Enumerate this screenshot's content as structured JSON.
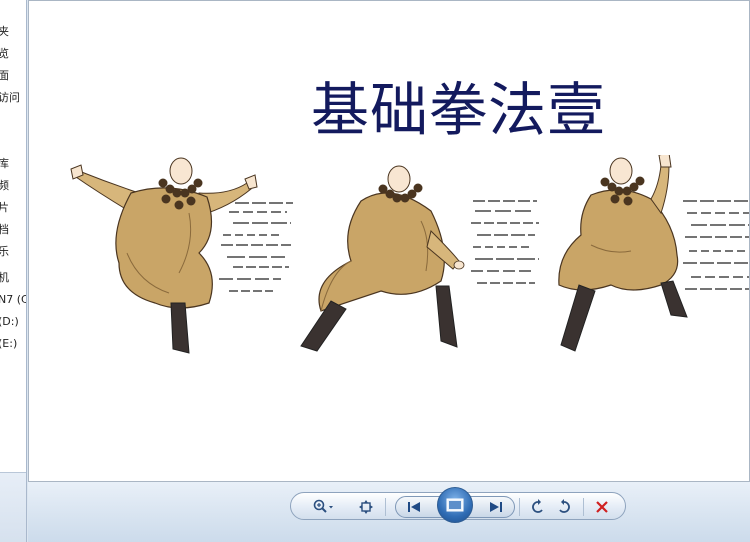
{
  "nav_pane": {
    "items": [
      "夹",
      "览",
      "面",
      "访问",
      "库",
      "频",
      "片",
      "档",
      "乐",
      "机",
      "N7 (C",
      "(D:)",
      "(E:)"
    ]
  },
  "viewer": {
    "slide_title": "基础拳法壹"
  },
  "toolbar": {
    "zoom_icon": "zoom-icon",
    "fit_icon": "actual-size-icon",
    "prev_icon": "previous-icon",
    "slideshow_icon": "slideshow-icon",
    "next_icon": "next-icon",
    "rotate_ccw_icon": "rotate-counterclockwise-icon",
    "rotate_cw_icon": "rotate-clockwise-icon",
    "delete_icon": "delete-icon"
  },
  "colors": {
    "title": "#131a5e",
    "robe": "#c9a567",
    "delete": "#d02020"
  }
}
